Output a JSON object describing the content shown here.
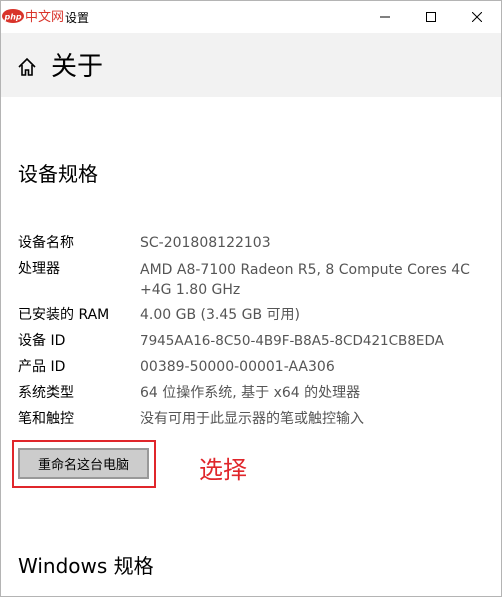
{
  "window": {
    "watermark": "中文网",
    "watermark_prefix": "php",
    "title": "设置"
  },
  "header": {
    "title": "关于"
  },
  "device_specs": {
    "section_title": "设备规格",
    "rows": [
      {
        "label": "设备名称",
        "value": "SC-201808122103"
      },
      {
        "label": "处理器",
        "value": "AMD A8-7100 Radeon R5, 8 Compute Cores 4C +4G     1.80 GHz"
      },
      {
        "label": "已安装的 RAM",
        "value": "4.00 GB (3.45 GB 可用)"
      },
      {
        "label": "设备 ID",
        "value": "7945AA16-8C50-4B9F-B8A5-8CD421CB8EDA"
      },
      {
        "label": "产品 ID",
        "value": "00389-50000-00001-AA306"
      },
      {
        "label": "系统类型",
        "value": "64 位操作系统, 基于 x64 的处理器"
      },
      {
        "label": "笔和触控",
        "value": "没有可用于此显示器的笔或触控输入"
      }
    ],
    "rename_button": "重命名这台电脑"
  },
  "annotation": {
    "text": "选择",
    "color": "#e0262b"
  },
  "windows_specs": {
    "section_title": "Windows 规格"
  }
}
